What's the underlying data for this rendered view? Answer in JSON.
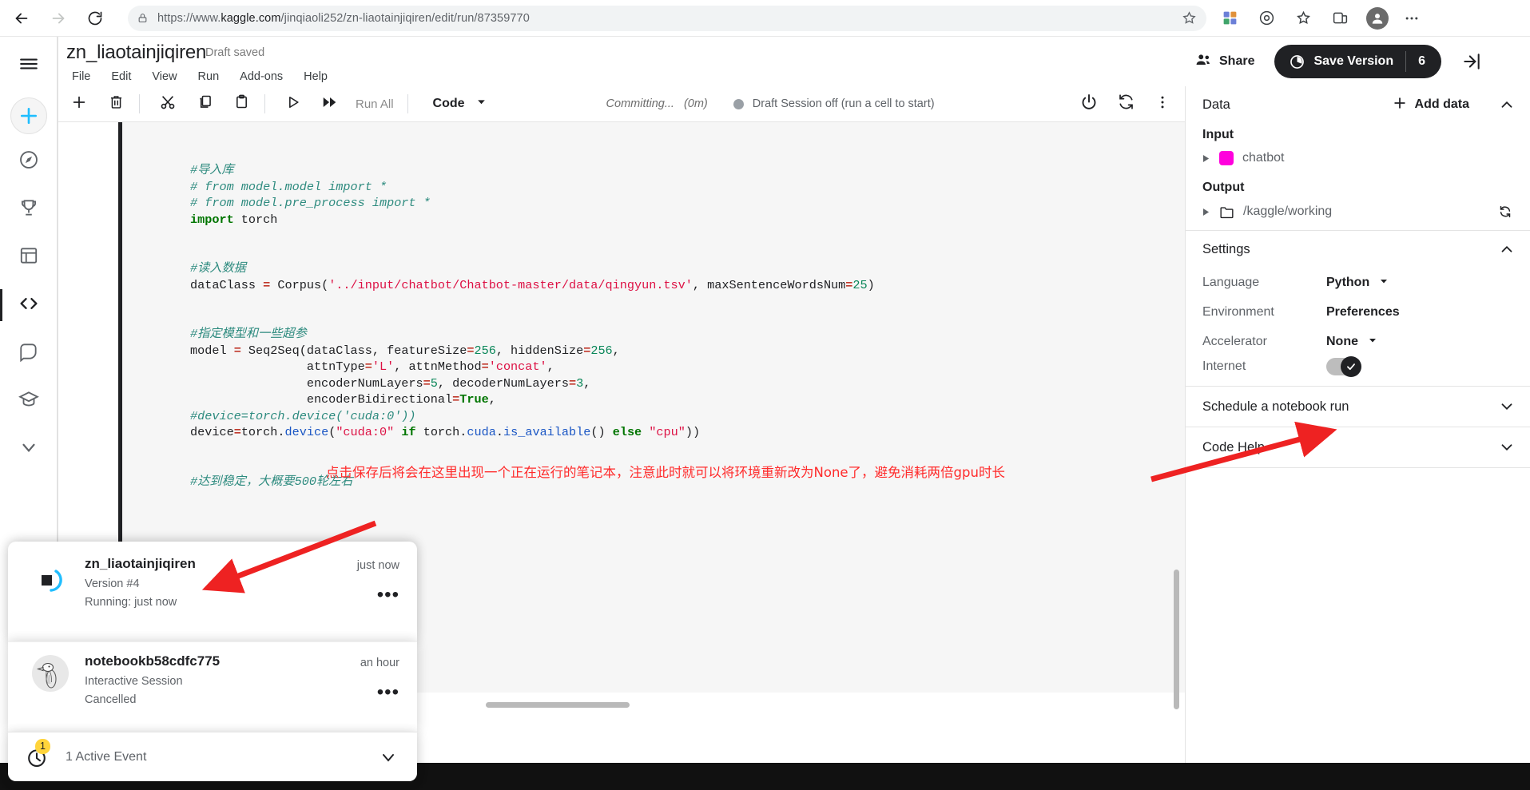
{
  "browser": {
    "url_scheme": "https://www.",
    "url_domain": "kaggle.com",
    "url_path": "/jinqiaoli252/zn-liaotainjiqiren/edit/run/87359770",
    "back_icon": "back-arrow-icon",
    "forward_icon": "forward-arrow-icon",
    "reload_icon": "reload-icon",
    "lock_icon": "lock-icon",
    "favorite_icon": "star-icon",
    "extensions_icon": "extensions-icon",
    "collections_icon": "collections-icon",
    "favorites_icon": "favorites-icon",
    "browser_essentials_icon": "browser-essentials-icon",
    "profile_icon": "profile-avatar-icon",
    "more_icon": "more-options-icon"
  },
  "rail": {
    "menu_icon": "hamburger-menu-icon",
    "create_icon": "plus-create-icon",
    "items": [
      {
        "icon": "compass-home-icon",
        "name": "home"
      },
      {
        "icon": "trophy-competitions-icon",
        "name": "competitions"
      },
      {
        "icon": "table-datasets-icon",
        "name": "datasets"
      },
      {
        "icon": "code-notebooks-icon",
        "name": "code"
      },
      {
        "icon": "discussion-icon",
        "name": "discussions"
      },
      {
        "icon": "learn-cap-icon",
        "name": "learn"
      },
      {
        "icon": "chevron-down-icon",
        "name": "more"
      }
    ]
  },
  "notebook": {
    "title": "zn_liaotainjiqiren",
    "draft_status": "Draft saved",
    "menus": [
      "File",
      "Edit",
      "View",
      "Run",
      "Add-ons",
      "Help"
    ],
    "share_label": "Share",
    "share_icon": "people-share-icon",
    "save_version_label": "Save Version",
    "save_version_icon": "clock-history-icon",
    "save_version_count": "6",
    "collapse_panel_icon": "collapse-right-panel-icon"
  },
  "toolbar": {
    "buttons": [
      {
        "icon": "plus-add-cell-icon",
        "name": "add-cell"
      },
      {
        "icon": "trash-delete-cell-icon",
        "name": "delete-cell"
      },
      {
        "icon": "scissors-cut-icon",
        "name": "cut-cell"
      },
      {
        "icon": "copy-icon",
        "name": "copy-cell"
      },
      {
        "icon": "clipboard-paste-icon",
        "name": "paste-cell"
      },
      {
        "icon": "play-run-icon",
        "name": "run-cell"
      },
      {
        "icon": "fast-forward-icon",
        "name": "run-all"
      }
    ],
    "run_all_label": "Run All",
    "cell_type": "Code",
    "cell_type_caret": "▾",
    "commit_status": "Committing...",
    "commit_elapsed": "(0m)",
    "session_status": "Draft Session off (run a cell to start)",
    "power_icon": "power-icon",
    "restart_icon": "restart-session-icon",
    "kebab_icon": "more-vertical-icon"
  },
  "code": {
    "lines": [
      {
        "t": "comment",
        "s": "#导入库"
      },
      {
        "t": "comment",
        "s": "# from model.model import *"
      },
      {
        "t": "comment",
        "s": "# from model.pre_process import *"
      },
      {
        "t": "mixed",
        "s": "import torch"
      },
      {
        "t": "blank",
        "s": ""
      },
      {
        "t": "blank",
        "s": ""
      },
      {
        "t": "comment",
        "s": "#读入数据"
      },
      {
        "t": "mixed",
        "s": "dataClass = Corpus('../input/chatbot/Chatbot-master/data/qingyun.tsv', maxSentenceWordsNum=25)"
      },
      {
        "t": "blank",
        "s": ""
      },
      {
        "t": "blank",
        "s": ""
      },
      {
        "t": "comment",
        "s": "#指定模型和一些超参"
      },
      {
        "t": "mixed",
        "s": "model = Seq2Seq(dataClass, featureSize=256, hiddenSize=256,"
      },
      {
        "t": "mixed",
        "s": "                attnType='L', attnMethod='concat',"
      },
      {
        "t": "mixed",
        "s": "                encoderNumLayers=5, decoderNumLayers=3,"
      },
      {
        "t": "mixed",
        "s": "                encoderBidirectional=True,"
      },
      {
        "t": "comment",
        "s": "#device=torch.device('cuda:0'))"
      },
      {
        "t": "mixed",
        "s": "device=torch.device(\"cuda:0\" if torch.cuda.is_available() else \"cpu\"))"
      },
      {
        "t": "blank",
        "s": ""
      },
      {
        "t": "blank",
        "s": ""
      },
      {
        "t": "comment",
        "s": "#达到稳定，大概要500轮左右"
      }
    ]
  },
  "right_panel": {
    "data": {
      "title": "Data",
      "add_data_label": "Add data",
      "add_data_icon": "plus-icon",
      "collapse_icon": "chevron-up-icon",
      "input_label": "Input",
      "input_items": [
        {
          "name": "chatbot",
          "swatch_color": "#ff00dd",
          "expand_icon": "triangle-right-icon"
        }
      ],
      "output_label": "Output",
      "output_items": [
        {
          "name": "/kaggle/working",
          "folder_icon": "folder-icon",
          "expand_icon": "triangle-right-icon",
          "refresh_icon": "refresh-icon"
        }
      ]
    },
    "settings": {
      "title": "Settings",
      "collapse_icon": "chevron-up-icon",
      "rows": [
        {
          "key": "Language",
          "value": "Python",
          "control": "dropdown"
        },
        {
          "key": "Environment",
          "value": "Preferences",
          "control": "link"
        },
        {
          "key": "Accelerator",
          "value": "None",
          "control": "dropdown"
        },
        {
          "key": "Internet",
          "value": "",
          "control": "toggle-on"
        }
      ]
    },
    "collapsed_sections": [
      {
        "label": "Schedule a notebook run",
        "icon": "chevron-down-icon"
      },
      {
        "label": "Code Help",
        "icon": "chevron-down-icon"
      }
    ]
  },
  "events_popup": {
    "items": [
      {
        "title": "zn_liaotainjiqiren",
        "subtitle": "Version #4",
        "status": "Running: just now",
        "time": "just now",
        "avatar": "running-spinner-icon",
        "more_icon": "ellipsis-icon"
      },
      {
        "title": "notebookb58cdfc775",
        "subtitle": "Interactive Session",
        "status": "Cancelled",
        "time": "an hour",
        "avatar": "goose-avatar-icon",
        "more_icon": "ellipsis-icon"
      }
    ],
    "footer_label": "1 Active Event",
    "footer_badge": "1",
    "footer_icon": "active-event-clock-icon",
    "footer_chevron": "chevron-down-icon"
  },
  "annotations": {
    "note_text": "点击保存后将会在这里出现一个正在运行的笔记本，注意此时就可以将环境重新改为None了，避免消耗两倍gpu时长",
    "note_color": "#ff2b2b",
    "arrow_color": "#ee2222"
  }
}
